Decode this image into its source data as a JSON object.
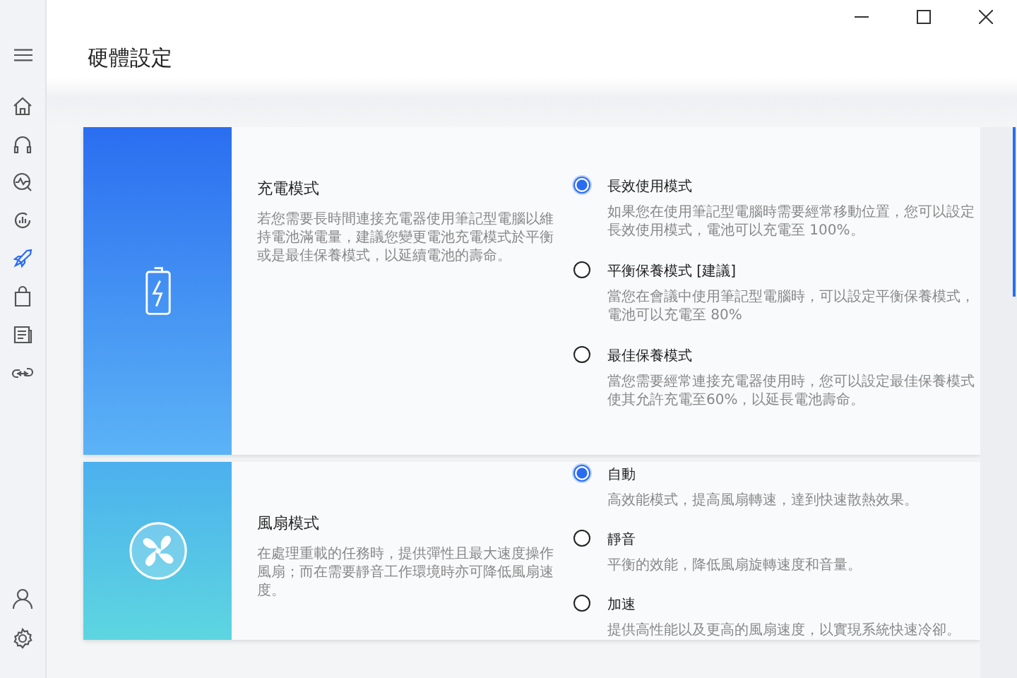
{
  "page": {
    "title": "硬體設定"
  },
  "sidebar": {
    "items": [
      {
        "selected": false
      },
      {
        "selected": false
      },
      {
        "selected": false
      },
      {
        "selected": false
      },
      {
        "selected": true
      },
      {
        "selected": false
      },
      {
        "selected": false
      },
      {
        "selected": false
      }
    ]
  },
  "sections": [
    {
      "kind": "battery",
      "title": "充電模式",
      "description": "若您需要長時間連接充電器使用筆記型電腦以維持電池滿電量，建議您變更電池充電模式於平衡或是最佳保養模式，以延續電池的壽命。",
      "options": [
        {
          "label": "長效使用模式",
          "description": "如果您在使用筆記型電腦時需要經常移動位置，您可以設定長效使用模式，電池可以充電至 100%。",
          "selected": true
        },
        {
          "label": "平衡保養模式 [建議]",
          "description": "當您在會議中使用筆記型電腦時，可以設定平衡保養模式，電池可以充電至 80%",
          "selected": false
        },
        {
          "label": "最佳保養模式",
          "description": "當您需要經常連接充電器使用時，您可以設定最佳保養模式使其允許充電至60%，以延長電池壽命。",
          "selected": false
        }
      ]
    },
    {
      "kind": "fan",
      "title": "風扇模式",
      "description": "在處理重載的任務時，提供彈性且最大速度操作風扇；而在需要靜音工作環境時亦可降低風扇速度。",
      "options": [
        {
          "label": "自動",
          "description": "高效能模式，提高風扇轉速，達到快速散熱效果。",
          "selected": true
        },
        {
          "label": "靜音",
          "description": "平衡的效能，降低風扇旋轉速度和音量。",
          "selected": false
        },
        {
          "label": "加速",
          "description": "提供高性能以及更高的風扇速度，以實現系統快速冷卻。",
          "selected": false
        }
      ]
    }
  ]
}
